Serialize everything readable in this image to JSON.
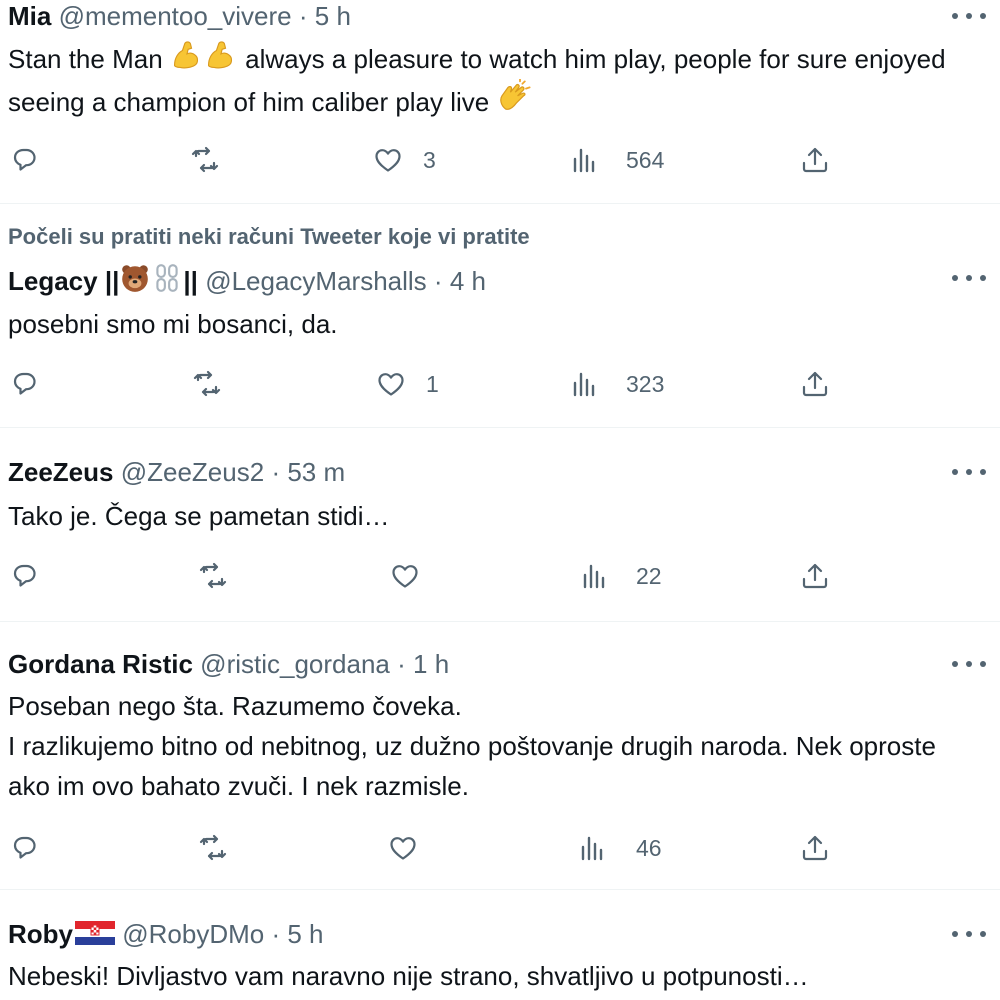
{
  "tweets": [
    {
      "name": "Mia",
      "handle": "@mementoo_vivere",
      "sep": "·",
      "time": "5 h",
      "text_a": "Stan the Man ",
      "text_b": " always a pleasure to watch him play, people for sure enjoyed seeing a champion of him caliber play live ",
      "likes": "3",
      "views": "564"
    },
    {
      "context": "Počeli su pratiti neki računi Tweeter koje vi pratite",
      "name": "Legacy ||",
      "name_b": "||",
      "handle": "@LegacyMarshalls",
      "sep": "·",
      "time": "4 h",
      "text": "posebni smo mi bosanci, da.",
      "likes": "1",
      "views": "323"
    },
    {
      "name": "ZeeZeus",
      "handle": "@ZeeZeus2",
      "sep": "·",
      "time": "53 m",
      "text": "Tako je. Čega se pametan stidi…",
      "likes": "",
      "views": "22"
    },
    {
      "name": "Gordana Ristic",
      "handle": "@ristic_gordana",
      "sep": "·",
      "time": "1 h",
      "text": "Poseban nego šta. Razumemo čoveka.\nI razlikujemo bitno od nebitnog, uz dužno poštovanje drugih naroda. Nek oproste ako im ovo bahato zvuči. I nek razmisle.",
      "likes": "",
      "views": "46"
    },
    {
      "name": "Roby",
      "handle": "@RobyDMo",
      "sep": "·",
      "time": "5 h",
      "text": "Nebeski! Divljastvo vam naravno nije strano, shvatljivo u potpunosti…"
    }
  ],
  "icons": [
    "reply-icon",
    "retweet-icon",
    "like-icon",
    "views-icon",
    "share-icon",
    "more-icon",
    "flexed-biceps-emoji",
    "clapping-hands-emoji",
    "bear-emoji",
    "chain-emoji",
    "croatia-flag"
  ],
  "colors": {
    "text": "#0f1419",
    "secondary": "#536471",
    "divider": "#eff3f4",
    "background": "#ffffff"
  }
}
